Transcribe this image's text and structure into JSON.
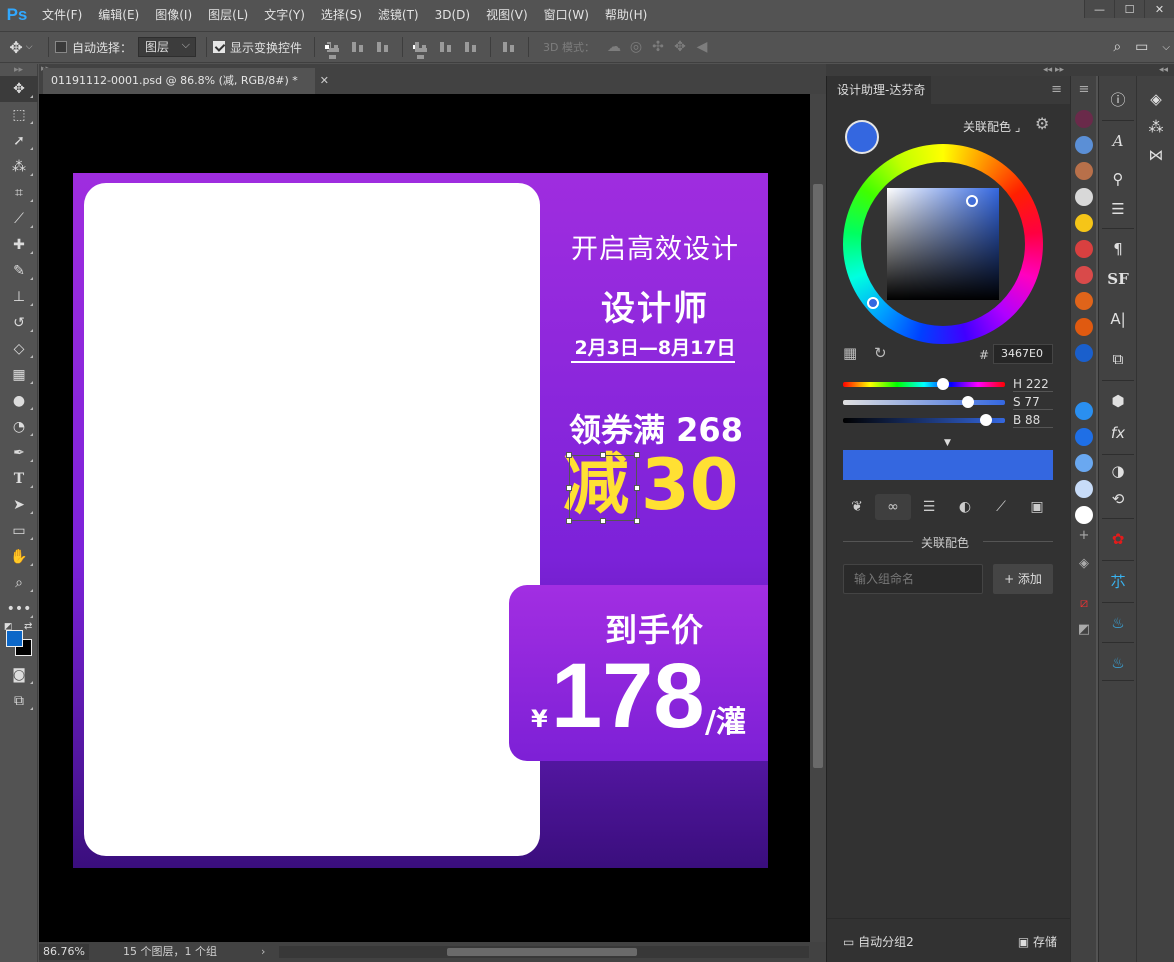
{
  "app": {
    "logo": "Ps"
  },
  "menu": [
    "文件(F)",
    "编辑(E)",
    "图像(I)",
    "图层(L)",
    "文字(Y)",
    "选择(S)",
    "滤镜(T)",
    "3D(D)",
    "视图(V)",
    "窗口(W)",
    "帮助(H)"
  ],
  "options": {
    "auto_select_label": "自动选择：",
    "auto_select_value": "图层",
    "show_transform_label": "显示变换控件",
    "mode_3d_label": "3D 模式："
  },
  "document": {
    "tab_title": "01191112-0001.psd @ 86.8% (减, RGB/8#) *",
    "zoom": "86.76%",
    "layers_info": "15 个图层，1 个组"
  },
  "artwork": {
    "line1": "开启高效设计",
    "line2": "设计师",
    "date": "2月3日—8月17日",
    "coupon": "领券满 268",
    "minus": "减",
    "amount": "30",
    "price_label": "到手价",
    "currency": "¥",
    "price": "178",
    "unit": "/灌"
  },
  "color_panel": {
    "tab": "设计助理-达芬奇",
    "assoc_label": "关联配色",
    "hex_label": "#",
    "hex": "3467E0",
    "h_label": "H 222",
    "s_label": "S 77",
    "b_label": "B 88",
    "h": 222,
    "s": 77,
    "b": 88,
    "current_color": "#3467e0",
    "section_title": "关联配色",
    "group_placeholder": "输入组命名",
    "add_label": "+ 添加",
    "auto_group": "自动分组2",
    "save_label": "存储"
  },
  "swatches": [
    "#6a2a4a",
    "#5b8fd6",
    "#b8704a",
    "#d8d8d8",
    "#f5c518",
    "#d94040",
    "#d94a4a",
    "#e0641a",
    "#e05a10",
    "#1a5fcc",
    "#2a8ff0",
    "#1f6fe6",
    "#6aa8f0",
    "#c8dcf8",
    "#ffffff"
  ],
  "colors": {
    "foreground": "#0c67c8",
    "background": "#000000",
    "accent": "#3467e0",
    "art_yellow": "#ffe033"
  }
}
